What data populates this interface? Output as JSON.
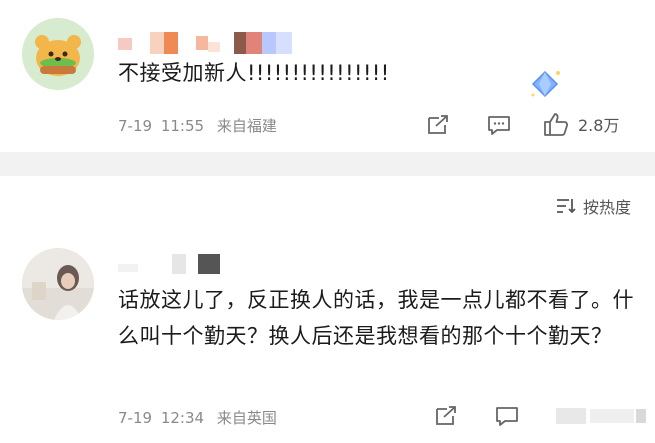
{
  "comments": [
    {
      "text": "不接受加新人!!!!!!!!!!!!!!!!",
      "date": "7-19",
      "time": "11:55",
      "location": "来自福建",
      "like_count": "2.8万"
    },
    {
      "text": "话放这儿了，反正换人的话，我是一点儿都不看了。什么叫十个勤天？换人后还是我想看的那个十个勤天？",
      "date": "7-19",
      "time": "12:34",
      "location": "来自英国"
    }
  ],
  "sort": {
    "label": "按热度"
  },
  "colors": {
    "meta_gray": "#8a8a8a",
    "divider": "#f2f2f2",
    "diamond_blue": "#6fa3ff"
  },
  "icons": [
    "share-icon",
    "comment-icon",
    "like-icon",
    "sort-icon",
    "diamond-icon"
  ]
}
